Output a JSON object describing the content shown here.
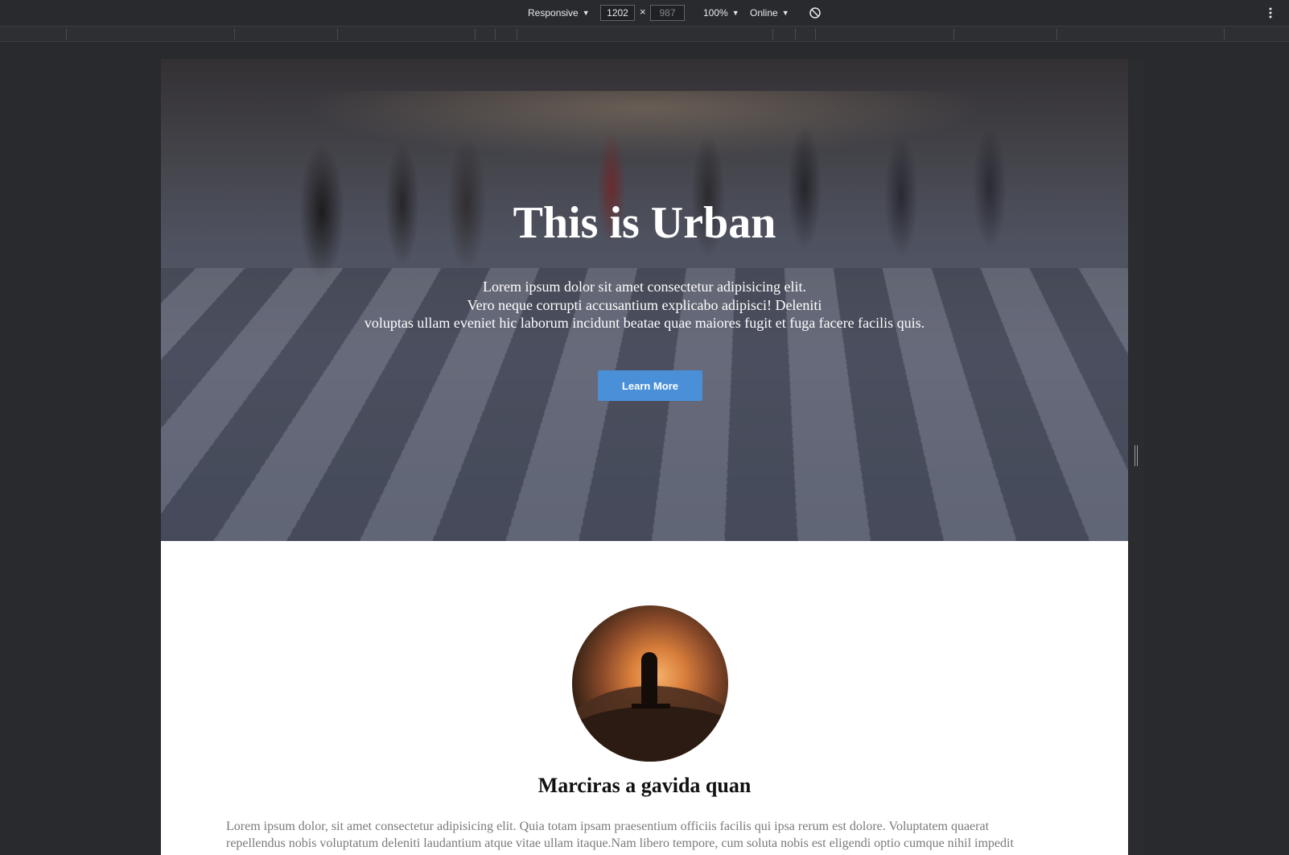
{
  "devtools": {
    "device_mode": "Responsive",
    "width": "1202",
    "height": "987",
    "zoom": "100%",
    "throttling": "Online",
    "icons": {
      "rotate": "rotate-icon",
      "more": "more-vertical-icon"
    }
  },
  "hero": {
    "title": "This is Urban",
    "lines": [
      "Lorem ipsum dolor sit amet consectetur adipisicing elit.",
      "Vero neque corrupti accusantium explicabo adipisci! Deleniti",
      "voluptas ullam eveniet hic laborum incidunt beatae quae maiores fugit et fuga facere facilis quis."
    ],
    "button_label": "Learn More"
  },
  "section": {
    "title": "Marciras a gavida quan",
    "lines": [
      "Lorem ipsum dolor, sit amet consectetur adipisicing elit. Quia totam ipsam praesentium officiis facilis qui ipsa rerum est dolore. Voluptatem quaerat",
      "repellendus nobis voluptatum deleniti laudantium atque vitae ullam itaque.Nam libero tempore, cum soluta nobis est eligendi optio cumque nihil impedit"
    ]
  },
  "colors": {
    "accent": "#4a90d9",
    "devtools_bg": "#292a2d"
  }
}
